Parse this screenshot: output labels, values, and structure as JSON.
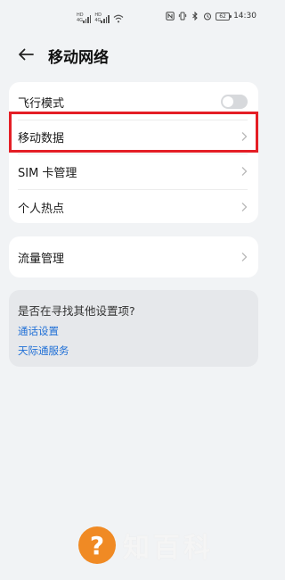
{
  "status_bar": {
    "left_icons": [
      "sim1-signal-icon",
      "sim2-signal-icon",
      "wifi-icon"
    ],
    "sim1_tags": [
      "HD",
      "4G"
    ],
    "sim2_tags": [
      "HD",
      "4G"
    ],
    "right_icons": [
      "nfc-icon",
      "vibrate-icon",
      "bluetooth-icon",
      "alarm-icon"
    ],
    "battery": "62",
    "time": "14:30"
  },
  "header": {
    "title": "移动网络"
  },
  "card1": {
    "items": [
      {
        "label": "飞行模式",
        "control": "toggle",
        "on": false
      },
      {
        "label": "移动数据",
        "control": "chevron"
      },
      {
        "label": "SIM 卡管理",
        "control": "chevron"
      },
      {
        "label": "个人热点",
        "control": "chevron"
      }
    ]
  },
  "card2": {
    "items": [
      {
        "label": "流量管理",
        "control": "chevron"
      }
    ]
  },
  "suggestions": {
    "question": "是否在寻找其他设置项?",
    "links": [
      "通话设置",
      "天际通服务"
    ]
  },
  "watermark": {
    "badge": "?",
    "text": "知百科"
  },
  "colors": {
    "background": "#f1f3f5",
    "card": "#ffffff",
    "link": "#1f6fd6",
    "highlight": "#e41e25",
    "watermark_badge": "#f08a24"
  }
}
